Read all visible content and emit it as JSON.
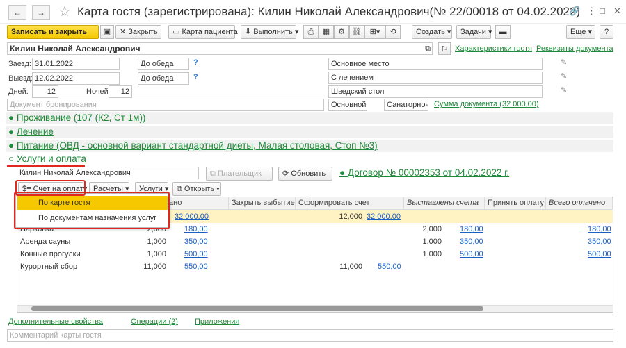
{
  "window": {
    "title": "Карта гостя (зарегистрирована): Килин Николай Александрович(№ 22/00018 от 04.02.2022)",
    "back": "←",
    "forward": "→"
  },
  "toolbar": {
    "save_close": "Записать и закрыть",
    "close": "Закрыть",
    "patient_card": "Карта пациента",
    "execute": "Выполнить",
    "create": "Создать",
    "tasks": "Задачи",
    "more": "Еще",
    "help": "?"
  },
  "header": {
    "guest_name": "Килин Николай Александрович",
    "characteristics_link": "Характеристики гостя",
    "details_link": "Реквизиты документа"
  },
  "form": {
    "arrival_label": "Заезд:",
    "arrival_date": "31.01.2022",
    "arrival_time": "До обеда",
    "departure_label": "Выезд:",
    "departure_date": "12.02.2022",
    "departure_time": "До обеда",
    "days_label": "Дней:",
    "days": "12",
    "nights_label": "Ночей:",
    "nights": "12",
    "booking_placeholder": "Документ бронирования",
    "place": "Основное место",
    "treatment": "С лечением",
    "table": "Шведский стол",
    "main_place_short": "Основной п",
    "sanatorium_card": "Санаторно-ку",
    "doc_sum_link": "Сумма документа (32 000,00)",
    "help_mark": "?"
  },
  "sections": {
    "accommodation": "Проживание (107 (К2, Ст 1м))",
    "treatment": "Лечение",
    "meals": "Питание (ОВД - основной вариант стандартной диеты, Малая столовая, Стоп №3)",
    "services": "Услуги и оплата"
  },
  "services": {
    "payer": "Килин Николай Александрович",
    "payer_button": "Плательщик",
    "refresh": "Обновить",
    "contract_link": "Договор № 00002353 от 04.02.2022 г.",
    "invoice_button": "Счет на оплату",
    "calculations": "Расчеты",
    "services_menu": "Услуги",
    "open_menu": "Открыть",
    "popup_items": [
      "По карте гостя",
      "По документам назначения услуг"
    ],
    "columns": [
      "",
      "ано",
      "Закрыть выбытием",
      "Сформировать счет",
      "Выставлены счета",
      "Принять оплату",
      "Всего оплачено"
    ],
    "rows": [
      {
        "name": "",
        "qty": "",
        "sum": "32 000,00",
        "form_qty": "12,000",
        "form_sum": "32 000,00",
        "inv_qty": "",
        "inv_sum": "",
        "paid": ""
      },
      {
        "name": "Парковка",
        "qty": "2,000",
        "sum": "180,00",
        "form_qty": "",
        "form_sum": "",
        "inv_qty": "2,000",
        "inv_sum": "180,00",
        "paid": "180,00"
      },
      {
        "name": "Аренда сауны",
        "qty": "1,000",
        "sum": "350,00",
        "form_qty": "",
        "form_sum": "",
        "inv_qty": "1,000",
        "inv_sum": "350,00",
        "paid": "350,00"
      },
      {
        "name": "Конные прогулки",
        "qty": "1,000",
        "sum": "500,00",
        "form_qty": "",
        "form_sum": "",
        "inv_qty": "1,000",
        "inv_sum": "500,00",
        "paid": "500,00"
      },
      {
        "name": "Курортный сбор",
        "qty": "11,000",
        "sum": "550,00",
        "form_qty": "11,000",
        "form_sum": "550,00",
        "inv_qty": "",
        "inv_sum": "",
        "paid": ""
      }
    ]
  },
  "footer": {
    "extra_props": "Дополнительные свойства",
    "operations": "Операции (2)",
    "attachments": "Приложения",
    "comment_placeholder": "Комментарий карты гостя"
  },
  "colors": {
    "accent": "#f5c800",
    "link": "#1f8a3b",
    "table_link": "#1a5fc5",
    "highlight": "#e0281f",
    "selected_row": "#fff3c4"
  }
}
